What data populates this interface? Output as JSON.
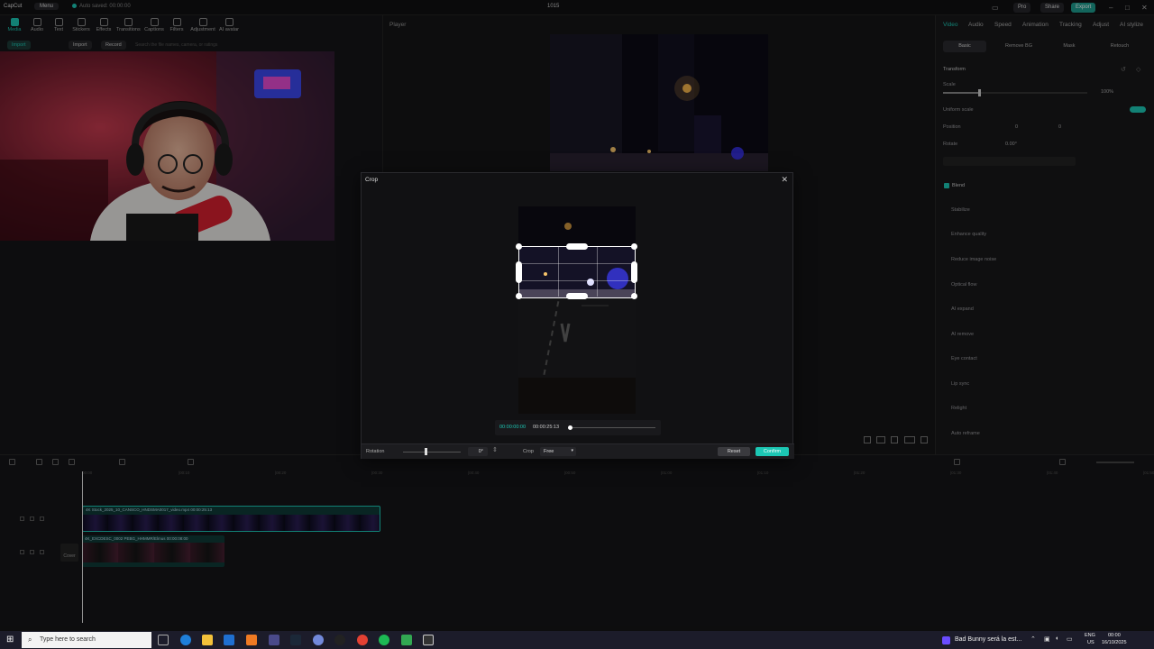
{
  "titlebar": {
    "app": "CapCut",
    "menu": "Menu",
    "autosave": "Auto saved: 00:00:00",
    "title": "1015",
    "pro": "Pro",
    "share": "Share",
    "export": "Export"
  },
  "toolbar": {
    "tools": [
      "Media",
      "Audio",
      "Text",
      "Stickers",
      "Effects",
      "Transitions",
      "Captions",
      "Filters",
      "Adjustment",
      "AI avatar"
    ]
  },
  "media": {
    "import": "Import",
    "record": "Record",
    "search_placeholder": "Search the file names, camera, or ratings"
  },
  "player": {
    "label": "Player"
  },
  "inspector": {
    "tabs": [
      "Video",
      "Audio",
      "Speed",
      "Animation",
      "Tracking",
      "Adjust",
      "AI stylize"
    ],
    "subtabs": [
      "Basic",
      "Remove BG",
      "Mask",
      "Retouch"
    ],
    "transform": "Transform",
    "scale_label": "Scale",
    "scale_value": "100%",
    "scale_fraction": 0.25,
    "uniform_scale": "Uniform scale",
    "position_label": "Position",
    "pos_x": "0",
    "pos_y": "0",
    "rotate_label": "Rotate",
    "rotate_value": "0.00°",
    "blend": "Blend",
    "features": [
      "Stabilize",
      "Enhance quality",
      "Reduce image noise",
      "Optical flow",
      "AI expand",
      "AI remove",
      "Eye contact",
      "Lip sync",
      "Relight",
      "Auto reframe"
    ]
  },
  "crop": {
    "title": "Crop",
    "time_current": "00:00:00:00",
    "time_total": "00:00:25:13",
    "rotation_label": "Rotation",
    "rotation_value": "0°",
    "crop_label": "Crop",
    "crop_mode": "Free",
    "reset": "Reset",
    "confirm": "Confirm"
  },
  "timeline": {
    "clip1_label": "4K Stock_2025_10_CANSCO_HNDSMA0017_video.mp4  00:00:25:13",
    "clip2_label": "4K_EXCDESC_0002 PEBG_HHMMR/Elmus  00:00:08:00",
    "cover_label": "Cover",
    "ruler": [
      "00:00",
      "|00:10",
      "|00:20",
      "|00:30",
      "|00:40",
      "|00:50",
      "|01:00",
      "|01:10",
      "|01:20",
      "|01:30",
      "|01:40",
      "|01:50"
    ]
  },
  "taskbar": {
    "search": "Type here to search",
    "notification": "Bad Bunny será la est...",
    "lang1": "ENG",
    "lang2": "US",
    "time": "00:00",
    "date": "16/10/2025"
  },
  "colors": {
    "accent": "#1cc7b4",
    "export": "#1e9c8e",
    "background": "#141416"
  }
}
